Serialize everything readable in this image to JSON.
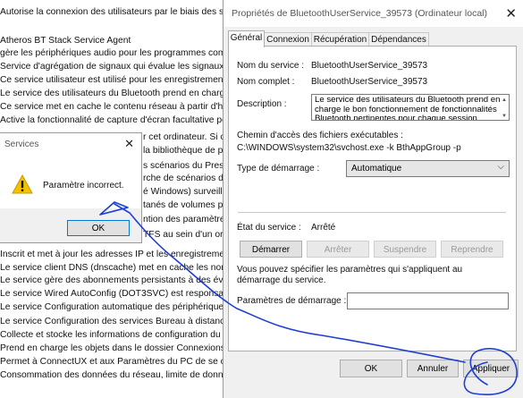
{
  "background_list": {
    "lines": [
      "Autorise la connexion des utilisateurs par le biais des servi",
      "",
      "Atheros BT Stack Service Agent",
      "gère les périphériques audio pour les programmes compa",
      "Service d'agrégation de signaux qui évalue les signaux en t",
      "Ce service utilisateur est utilisé pour les enregistrements de",
      "Le service des utilisateurs du Bluetooth prend en charge le",
      "Ce service met en cache le contenu réseau à partir d'homo",
      "Active la fonctionnalité de capture d'écran facultative pou",
      "r cet ordinateur. Si ce",
      "la bibliothèque de pe",
      "s scénarios du Presse",
      "rche de scénarios de p",
      "é Windows) surveille",
      "tanés de volumes po",
      "ntion des paramètres",
      "TFS au sein d'un ordi",
      "Inscrit et met à jour les adresses IP et les enregistrements D",
      "Le service client DNS (dnscache) met en cache les noms D",
      "Le service gère des abonnements persistants à des événem",
      "Le service Wired AutoConfig (DOT3SVC) est responsable de",
      "Le service Configuration automatique des périphériques co",
      "Le service Configuration des services Bureau à distance (RD",
      "Collecte et stocke les informations de configuration du rés",
      "Prend en charge les objets dans le dossier Connexions rése",
      "Permet à ConnectUX et aux Paramètres du PC de se conne",
      "Consommation des données du réseau, limite de données,"
    ]
  },
  "properties_dialog": {
    "title": "Propriétés de BluetoothUserService_39573 (Ordinateur local)",
    "close_glyph": "✕",
    "tabs": [
      "Général",
      "Connexion",
      "Récupération",
      "Dépendances"
    ],
    "active_tab": "Général",
    "service_name_label": "Nom du service :",
    "service_name_value": "BluetoothUserService_39573",
    "full_name_label": "Nom complet :",
    "full_name_value": "BluetoothUserService_39573",
    "description_label": "Description :",
    "description_value": "Le service des utilisateurs du Bluetooth prend en charge le bon fonctionnement de fonctionnalités Bluetooth pertinentes pour chaque session",
    "exe_path_label": "Chemin d'accès des fichiers exécutables :",
    "exe_path_value": "C:\\WINDOWS\\system32\\svchost.exe -k BthAppGroup -p",
    "startup_type_label": "Type de démarrage :",
    "startup_type_value": "Automatique",
    "service_state_label": "État du service :",
    "service_state_value": "Arrêté",
    "buttons": {
      "start": "Démarrer",
      "stop": "Arrêter",
      "pause": "Suspendre",
      "resume": "Reprendre"
    },
    "params_help": "Vous pouvez spécifier les paramètres qui s'appliquent au démarrage du service.",
    "start_params_label": "Paramètres de démarrage :",
    "start_params_value": "",
    "footer": {
      "ok": "OK",
      "cancel": "Annuler",
      "apply": "Appliquer"
    }
  },
  "error_dialog": {
    "title": "Services",
    "close_glyph": "✕",
    "message": "Paramètre incorrect.",
    "icon": "warning-icon",
    "ok": "OK"
  },
  "colors": {
    "annotation_blue": "#1f3fd0",
    "dialog_bg": "#f0f0f0",
    "focus_border": "#0078d7"
  }
}
